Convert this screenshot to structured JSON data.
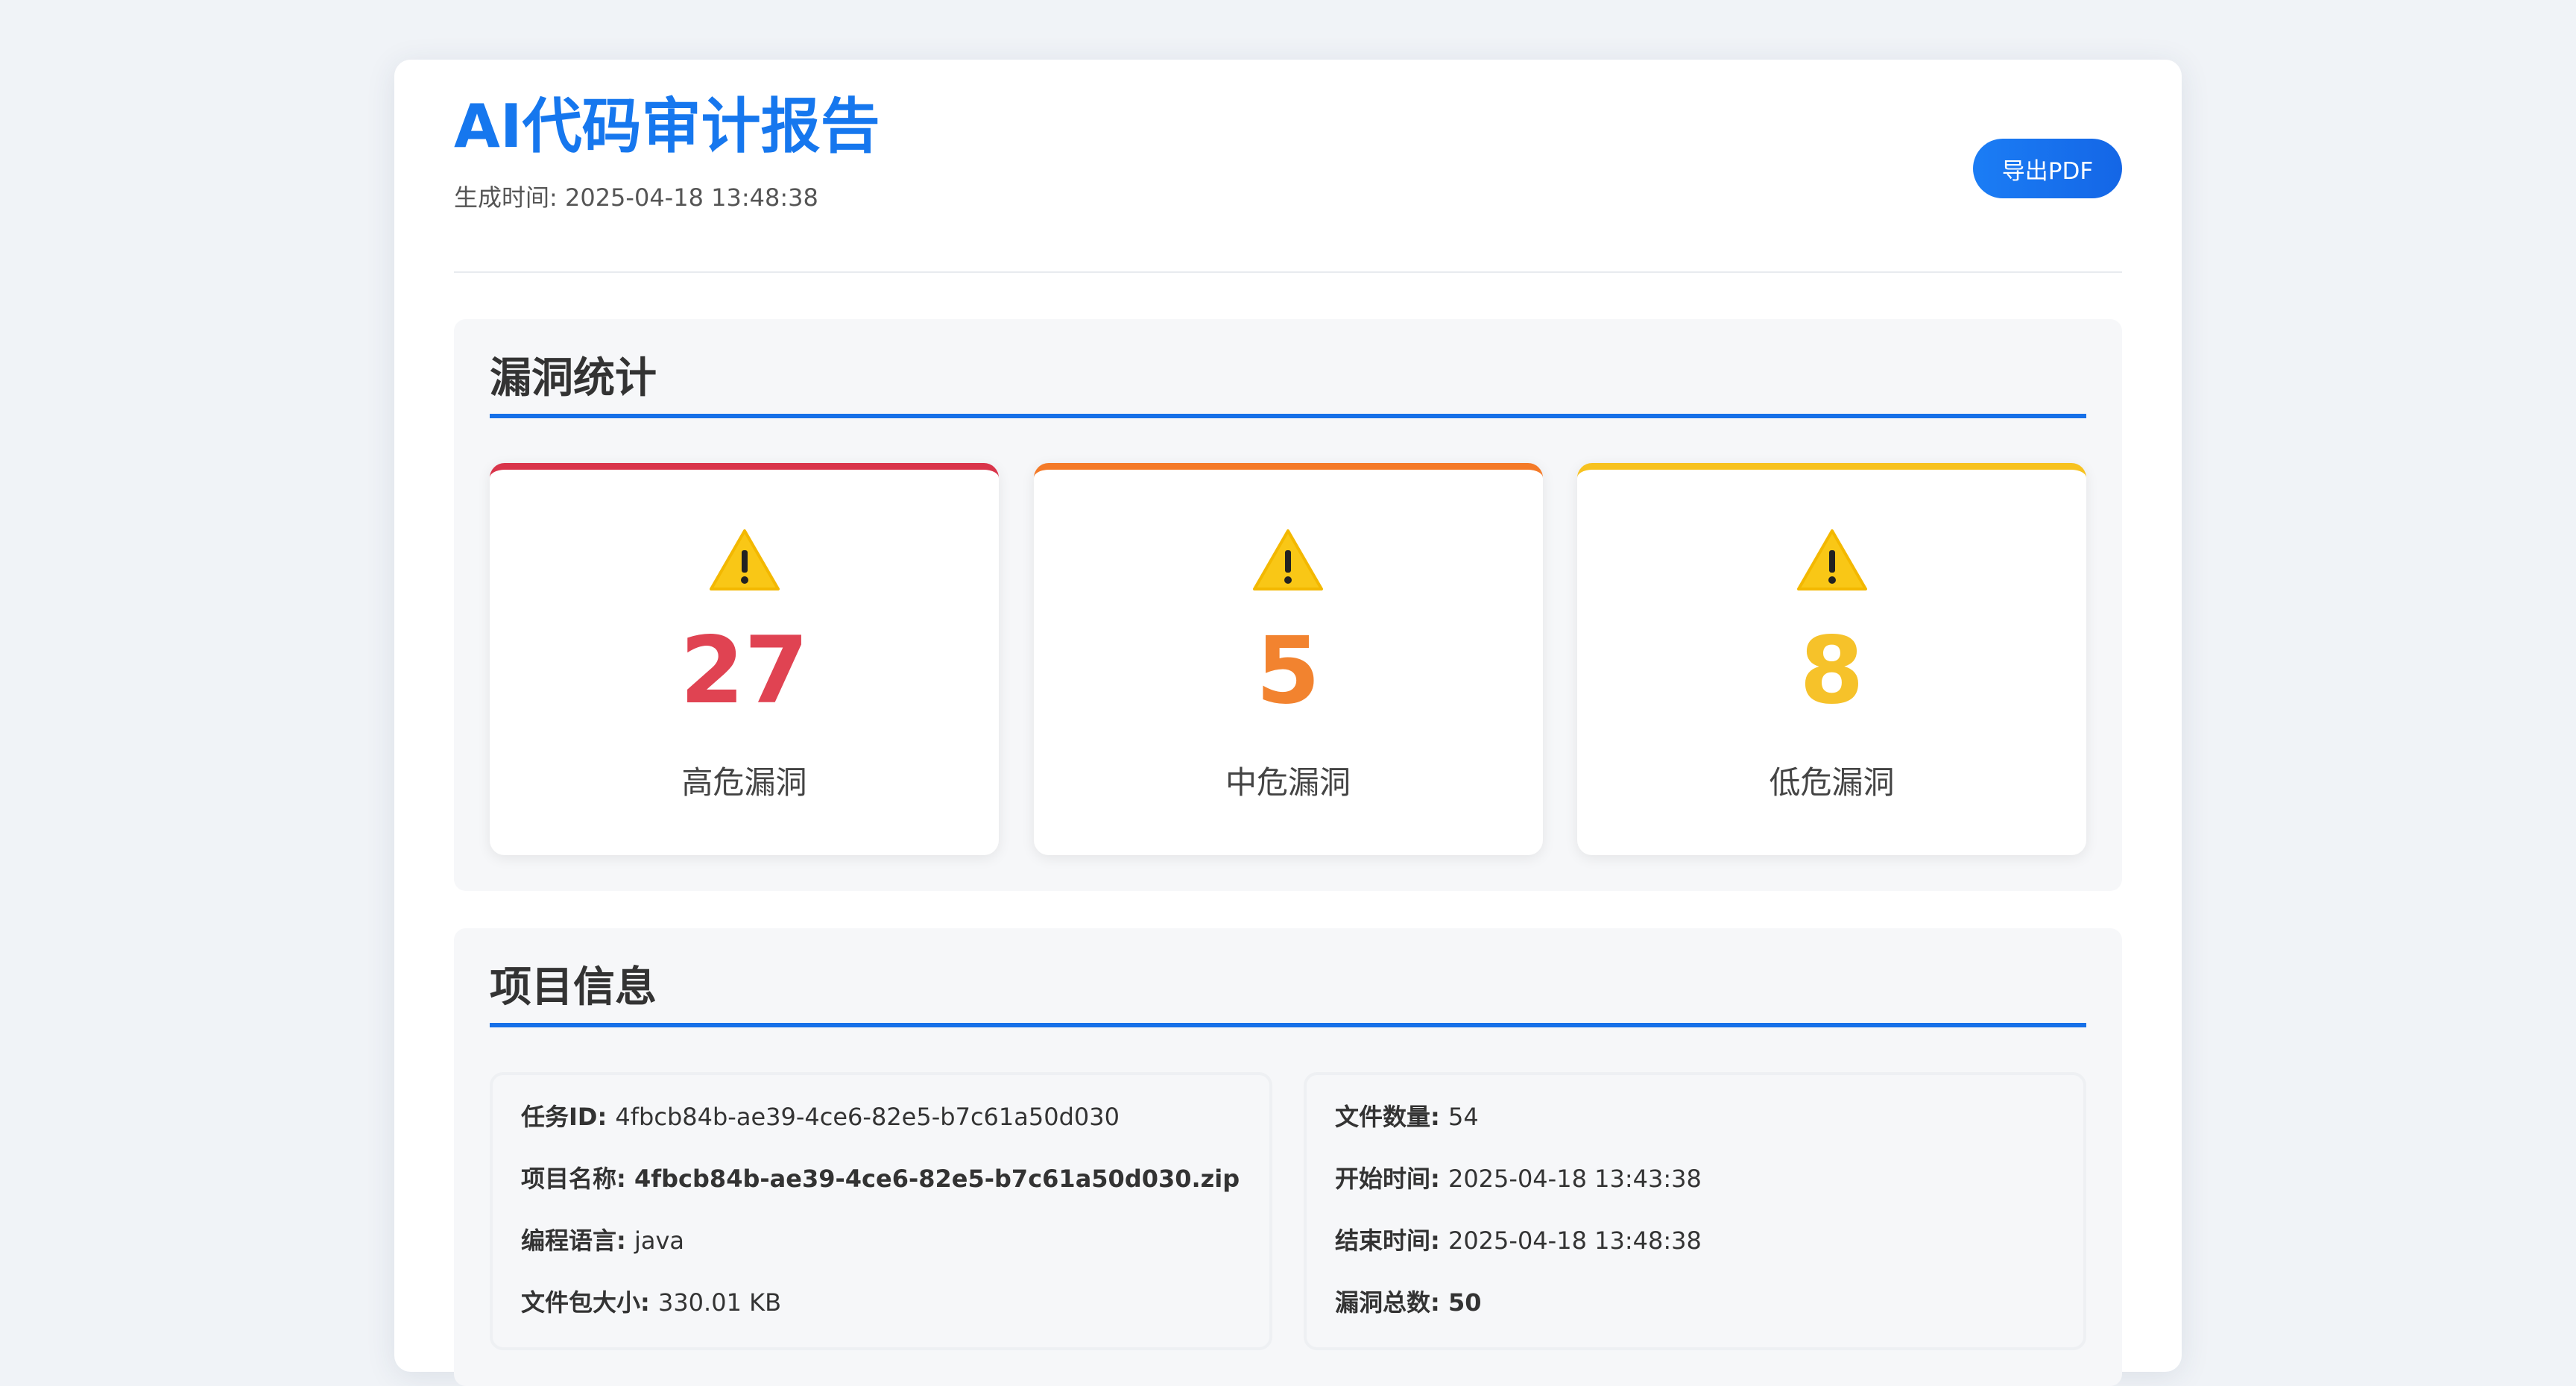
{
  "header": {
    "title": "AI代码审计报告",
    "generated_label": "生成时间: ",
    "generated_time": "2025-04-18 13:48:38",
    "export_button": "导出PDF"
  },
  "stats_section": {
    "title": "漏洞统计",
    "cards": [
      {
        "icon": "warning-icon",
        "count": "27",
        "label": "高危漏洞",
        "color": "#e04352"
      },
      {
        "icon": "warning-icon",
        "count": "5",
        "label": "中危漏洞",
        "color": "#f2832f"
      },
      {
        "icon": "warning-icon",
        "count": "8",
        "label": "低危漏洞",
        "color": "#f6c22a"
      }
    ]
  },
  "project_section": {
    "title": "项目信息",
    "left": [
      {
        "key": "任务ID: ",
        "value": "4fbcb84b-ae39-4ce6-82e5-b7c61a50d030"
      },
      {
        "key": "项目名称: ",
        "value": "4fbcb84b-ae39-4ce6-82e5-b7c61a50d030.zip"
      },
      {
        "key": "编程语言: ",
        "value": "java"
      },
      {
        "key": "文件包大小: ",
        "value": "330.01 KB"
      }
    ],
    "right": [
      {
        "key": "文件数量: ",
        "value": "54"
      },
      {
        "key": "开始时间: ",
        "value": "2025-04-18 13:43:38"
      },
      {
        "key": "结束时间: ",
        "value": "2025-04-18 13:48:38"
      },
      {
        "key": "漏洞总数: ",
        "value": "50"
      }
    ]
  },
  "colors": {
    "accent": "#1677ee",
    "high": "#d9344a",
    "medium": "#f47a28",
    "low": "#f7c21f"
  }
}
